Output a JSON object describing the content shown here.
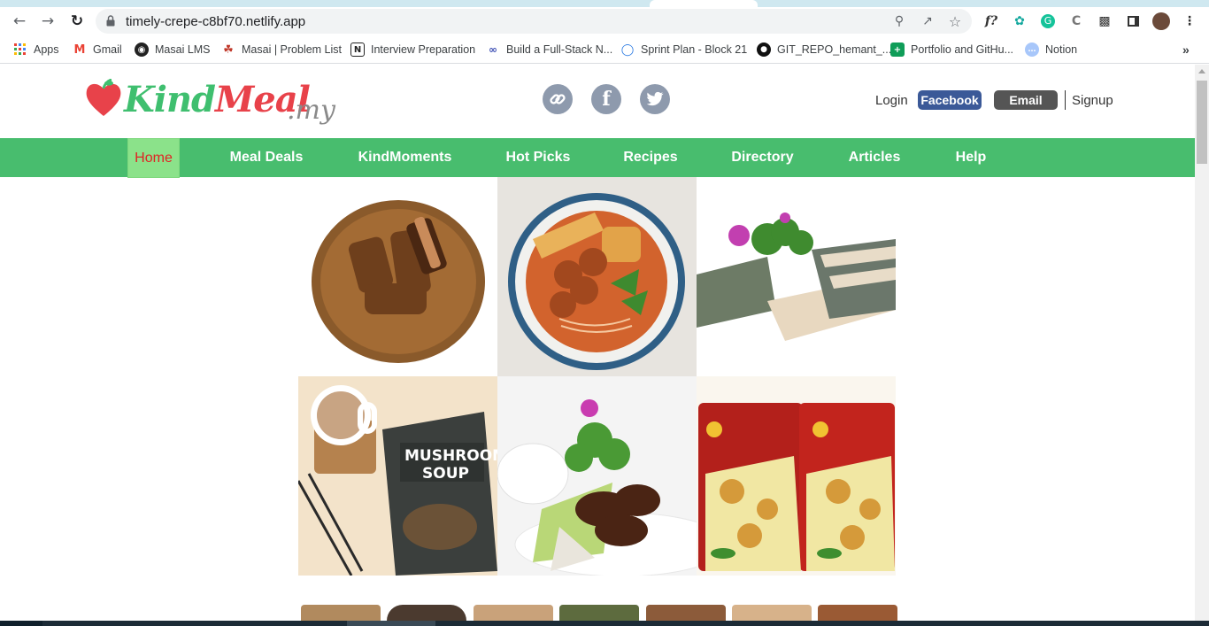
{
  "browser": {
    "url": "timely-crepe-c8bf70.netlify.app",
    "back_icon": "arrow-left-icon",
    "forward_icon": "arrow-right-icon",
    "reload_icon": "reload-icon",
    "extensions": [
      "fx-icon",
      "chatgpt-icon",
      "grammarly-icon",
      "css-icon",
      "puzzle-icon",
      "sidepanel-icon",
      "avatar",
      "menu-icon"
    ]
  },
  "bookmarks": [
    {
      "label": "Apps",
      "icon": "apps-grid-icon"
    },
    {
      "label": "Gmail",
      "icon": "gmail-icon"
    },
    {
      "label": "Masai LMS",
      "icon": "globe-icon"
    },
    {
      "label": "Masai | Problem List",
      "icon": "masai-icon"
    },
    {
      "label": "Interview Preparation",
      "icon": "notion-icon"
    },
    {
      "label": "Build a Full-Stack N...",
      "icon": "link-icon"
    },
    {
      "label": "Sprint Plan - Block 21",
      "icon": "drop-icon"
    },
    {
      "label": "GIT_REPO_hemant_...",
      "icon": "github-icon"
    },
    {
      "label": "Portfolio and GitHu...",
      "icon": "sheets-icon"
    },
    {
      "label": "Notion",
      "icon": "chat-icon"
    }
  ],
  "site": {
    "logo": {
      "kind": "Kind",
      "meal": "Meal",
      "suffix": ".my"
    },
    "social": [
      "link-icon",
      "facebook-icon",
      "twitter-icon"
    ],
    "auth": {
      "login": "Login",
      "facebook": "Facebook",
      "email": "Email",
      "signup": "Signup"
    },
    "nav": [
      "Home",
      "Meal Deals",
      "KindMoments",
      "Hot Picks",
      "Recipes",
      "Directory",
      "Articles",
      "Help"
    ],
    "active_nav": "Home",
    "colors": {
      "brand_green": "#48bd6e",
      "active_bg": "#8be28a",
      "active_text": "#e02424",
      "facebook": "#3b5998",
      "email": "#555555"
    }
  },
  "gallery": [
    {
      "name": "braised-pork-rice-image"
    },
    {
      "name": "noodle-soup-image"
    },
    {
      "name": "seaweed-tofu-image"
    },
    {
      "name": "mushroom-soup-pack-image"
    },
    {
      "name": "bao-dish-image"
    },
    {
      "name": "snack-packs-image"
    }
  ]
}
